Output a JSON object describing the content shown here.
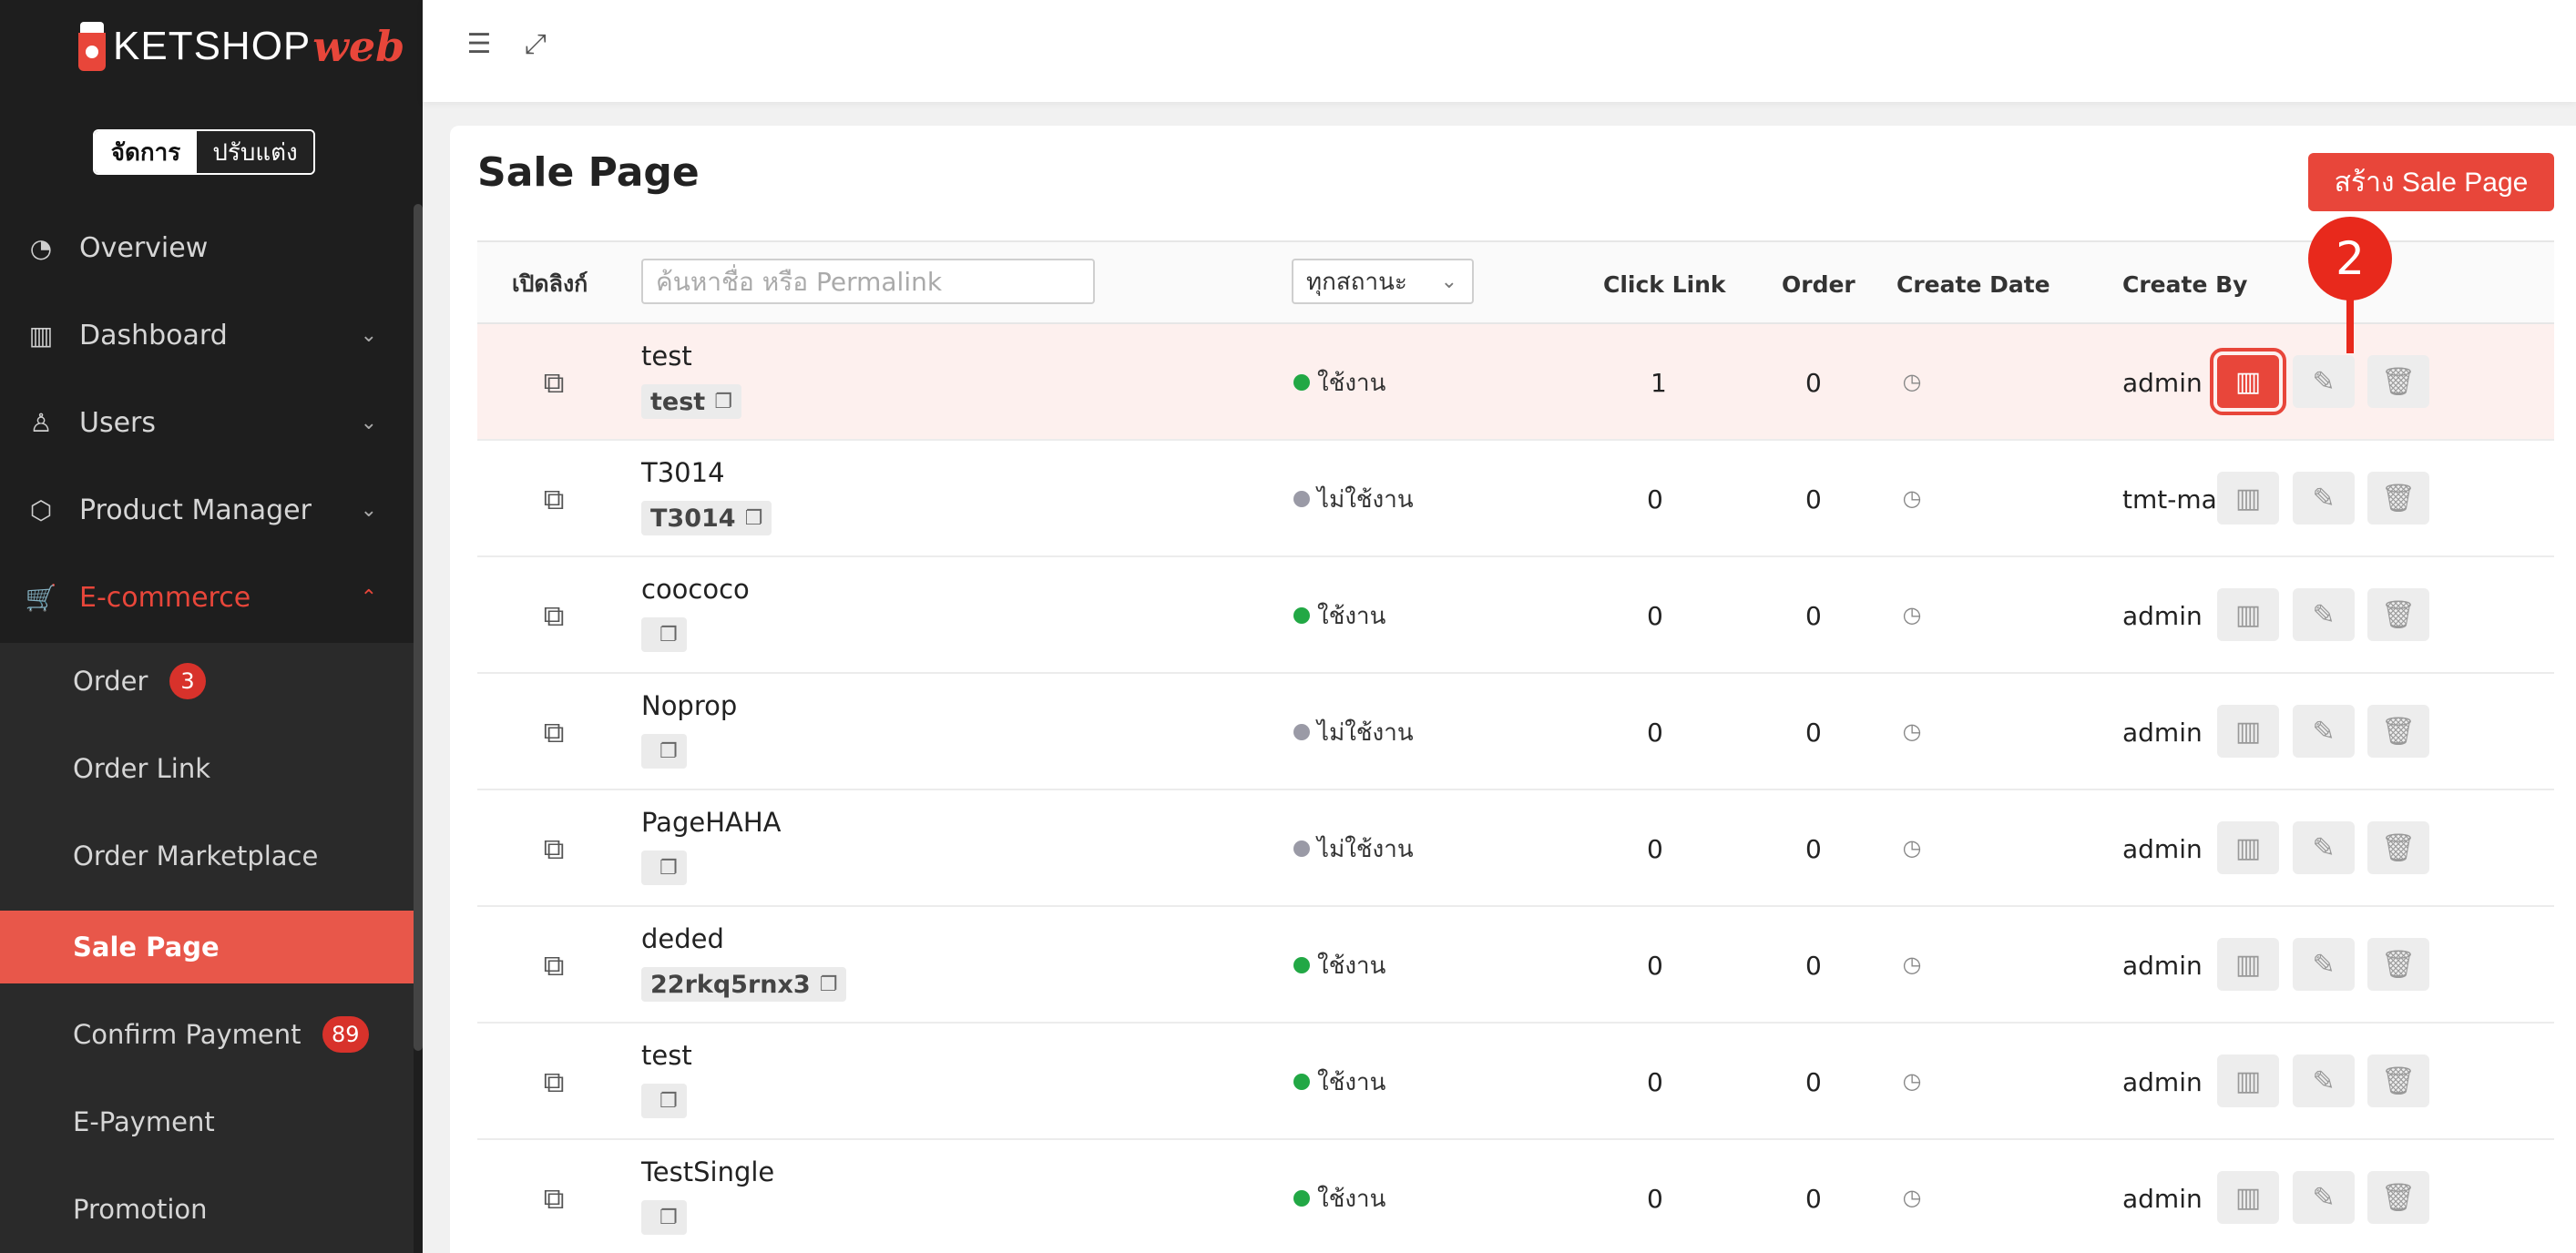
{
  "app": {
    "brand": "KETSHOP",
    "brand_suffix": "web"
  },
  "mode_toggle": {
    "manage": "จัดการ",
    "customize": "ปรับแต่ง"
  },
  "sidebar": {
    "items": [
      {
        "label": "Overview",
        "icon": "pie-chart-icon"
      },
      {
        "label": "Dashboard",
        "icon": "bar-chart-icon"
      },
      {
        "label": "Users",
        "icon": "user-icon"
      },
      {
        "label": "Product Manager",
        "icon": "box-icon"
      },
      {
        "label": "E-commerce",
        "icon": "cart-icon"
      }
    ],
    "sub_items": [
      {
        "label": "Order",
        "badge": "3"
      },
      {
        "label": "Order Link"
      },
      {
        "label": "Order Marketplace"
      },
      {
        "label": "Sale Page"
      },
      {
        "label": "Confirm Payment",
        "badge": "89"
      },
      {
        "label": "E-Payment"
      },
      {
        "label": "Promotion"
      }
    ]
  },
  "page": {
    "title": "Sale Page",
    "create_button": "สร้าง Sale Page"
  },
  "table": {
    "headers": {
      "open_link": "เปิดลิงก์",
      "search_placeholder": "ค้นหาชื่อ หรือ Permalink",
      "status_filter": "ทุกสถานะ",
      "click_link": "Click Link",
      "order": "Order",
      "create_date": "Create Date",
      "create_by": "Create By"
    },
    "rows": [
      {
        "name": "test",
        "permalink": "test",
        "status": "ใช้งาน",
        "click_link": "1",
        "order": "0",
        "create_by": "admin"
      },
      {
        "name": "T3014",
        "permalink": "T3014",
        "status": "ไม่ใช้งาน",
        "click_link": "0",
        "order": "0",
        "create_by": "tmt-may"
      },
      {
        "name": "coococo",
        "permalink": "",
        "status": "ใช้งาน",
        "click_link": "0",
        "order": "0",
        "create_by": "admin"
      },
      {
        "name": "Noprop",
        "permalink": "",
        "status": "ไม่ใช้งาน",
        "click_link": "0",
        "order": "0",
        "create_by": "admin"
      },
      {
        "name": "PageHAHA",
        "permalink": "",
        "status": "ไม่ใช้งาน",
        "click_link": "0",
        "order": "0",
        "create_by": "admin"
      },
      {
        "name": "deded",
        "permalink": "22rkq5rnx3",
        "status": "ใช้งาน",
        "click_link": "0",
        "order": "0",
        "create_by": "admin"
      },
      {
        "name": "test",
        "permalink": "",
        "status": "ใช้งาน",
        "click_link": "0",
        "order": "0",
        "create_by": "admin"
      },
      {
        "name": "TestSingle",
        "permalink": "",
        "status": "ใช้งาน",
        "click_link": "0",
        "order": "0",
        "create_by": "admin"
      }
    ]
  },
  "annotation": {
    "step": "2"
  },
  "colors": {
    "accent": "#e8463a",
    "active_status": "#22a845",
    "inactive_status": "#9a9aa6"
  }
}
